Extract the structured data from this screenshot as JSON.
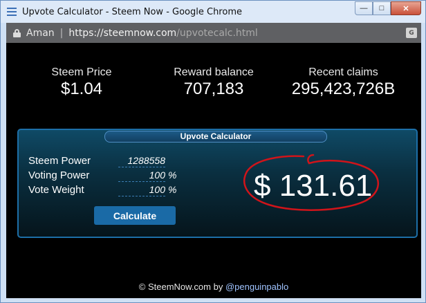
{
  "window": {
    "title": "Upvote Calculator - Steem Now - Google Chrome",
    "minimize_glyph": "—",
    "maximize_glyph": "□",
    "close_glyph": "✕"
  },
  "addressbar": {
    "site_name": "Aman",
    "separator": "|",
    "url_host": "https://steemnow.com",
    "url_path": "/upvotecalc.html",
    "translate_glyph": "G"
  },
  "stats": {
    "price_label": "Steem Price",
    "price_value": "$1.04",
    "reward_label": "Reward balance",
    "reward_value": "707,183",
    "claims_label": "Recent claims",
    "claims_value": "295,423,726B"
  },
  "calculator": {
    "header": "Upvote Calculator",
    "steem_power_label": "Steem Power",
    "steem_power_value": "1288558",
    "voting_power_label": "Voting Power",
    "voting_power_value": "100",
    "voting_power_suffix": "%",
    "vote_weight_label": "Vote Weight",
    "vote_weight_value": "100",
    "vote_weight_suffix": "%",
    "calculate_label": "Calculate",
    "result": "$ 131.61"
  },
  "footer": {
    "copyright": "© SteemNow.com by ",
    "author": "@penguinpablo"
  },
  "colors": {
    "accent": "#1a6aa6",
    "annotation": "#d0141a"
  }
}
